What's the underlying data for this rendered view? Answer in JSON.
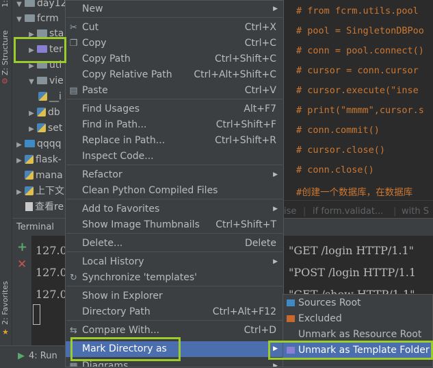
{
  "left_strip": {
    "structure_label": "Z: Structure",
    "favorites_label": "2: Favorites",
    "project_label": "1:"
  },
  "tree": {
    "rows": [
      {
        "label": "day12",
        "kind": "folder"
      },
      {
        "label": "fcrm",
        "kind": "folder"
      },
      {
        "label": "sta",
        "kind": "folder"
      },
      {
        "label": "ter",
        "kind": "folder-purple"
      },
      {
        "label": "uti",
        "kind": "folder"
      },
      {
        "label": "vie",
        "kind": "folder"
      },
      {
        "label": "__i",
        "kind": "python"
      },
      {
        "label": "db",
        "kind": "python"
      },
      {
        "label": "set",
        "kind": "python"
      },
      {
        "label": "qqqq",
        "kind": "folder-blue"
      },
      {
        "label": "flask-",
        "kind": "python"
      },
      {
        "label": "mana",
        "kind": "python"
      },
      {
        "label": "上下文",
        "kind": "python"
      },
      {
        "label": "查看re",
        "kind": "doc"
      }
    ]
  },
  "editor": {
    "lines": [
      "# from fcrm.utils.pool",
      "# pool = SingletonDBPoo",
      "# conn = pool.connect()",
      "# cursor = conn.cursor",
      "# cursor.execute(\"inse",
      "# print(\"mmmm\",cursor.s",
      "# conn.commit()",
      "# cursor.close()",
      "# conn.close()",
      "#创建一个数据库，在数据库"
    ],
    "breadcrumb": [
      "ise",
      "if form.validat...",
      "with S"
    ]
  },
  "terminal": {
    "title": "Terminal",
    "lines": [
      {
        "ip": "127.0",
        "req": "\"GET /login HTTP/1.1\""
      },
      {
        "ip": "127.0",
        "req": "\"POST /login HTTP/1.1"
      },
      {
        "ip": "127.0",
        "req": "\"GET /show HTTP/1.1\""
      }
    ],
    "run_label": "4: Run"
  },
  "menu": {
    "items": [
      {
        "label": "New",
        "shortcut": "",
        "submenu": true,
        "icon": ""
      },
      {
        "label": "Cut",
        "shortcut": "Ctrl+X",
        "submenu": false,
        "icon": "scissors-icon"
      },
      {
        "label": "Copy",
        "shortcut": "Ctrl+C",
        "submenu": false,
        "icon": "copy-icon"
      },
      {
        "label": "Copy Path",
        "shortcut": "Ctrl+Shift+C",
        "submenu": false,
        "icon": ""
      },
      {
        "label": "Copy Relative Path",
        "shortcut": "Ctrl+Alt+Shift+C",
        "submenu": false,
        "icon": ""
      },
      {
        "label": "Paste",
        "shortcut": "Ctrl+V",
        "submenu": false,
        "icon": "paste-icon"
      },
      {
        "label": "Find Usages",
        "shortcut": "Alt+F7",
        "submenu": false,
        "icon": ""
      },
      {
        "label": "Find in Path...",
        "shortcut": "Ctrl+Shift+F",
        "submenu": false,
        "icon": ""
      },
      {
        "label": "Replace in Path...",
        "shortcut": "Ctrl+Shift+R",
        "submenu": false,
        "icon": ""
      },
      {
        "label": "Inspect Code...",
        "shortcut": "",
        "submenu": false,
        "icon": ""
      },
      {
        "label": "Refactor",
        "shortcut": "",
        "submenu": true,
        "icon": ""
      },
      {
        "label": "Clean Python Compiled Files",
        "shortcut": "",
        "submenu": false,
        "icon": ""
      },
      {
        "label": "Add to Favorites",
        "shortcut": "",
        "submenu": true,
        "icon": ""
      },
      {
        "label": "Show Image Thumbnails",
        "shortcut": "Ctrl+Shift+T",
        "submenu": false,
        "icon": ""
      },
      {
        "label": "Delete...",
        "shortcut": "Delete",
        "submenu": false,
        "icon": ""
      },
      {
        "label": "Local History",
        "shortcut": "",
        "submenu": true,
        "icon": ""
      },
      {
        "label": "Synchronize 'templates'",
        "shortcut": "",
        "submenu": false,
        "icon": "sync-icon"
      },
      {
        "label": "Show in Explorer",
        "shortcut": "",
        "submenu": false,
        "icon": ""
      },
      {
        "label": "Directory Path",
        "shortcut": "Ctrl+Alt+F12",
        "submenu": false,
        "icon": ""
      },
      {
        "label": "Compare With...",
        "shortcut": "Ctrl+D",
        "submenu": false,
        "icon": "compare-icon"
      },
      {
        "label": "Mark Directory as",
        "shortcut": "",
        "submenu": true,
        "icon": ""
      },
      {
        "label": "Diagrams",
        "shortcut": "",
        "submenu": true,
        "icon": "diagram-icon"
      }
    ]
  },
  "submenu": {
    "items": [
      {
        "label": "Sources Root",
        "color": "#3d8ac4"
      },
      {
        "label": "Excluded",
        "color": "#c8682a"
      },
      {
        "label": "Unmark as Resource Root",
        "color": ""
      },
      {
        "label": "Unmark as Template Folder",
        "color": "#8a7fd4"
      }
    ]
  },
  "colors": {
    "selection": "#4b6eaf",
    "highlight_box": "#9ccc2c",
    "comment": "#cc7832"
  }
}
